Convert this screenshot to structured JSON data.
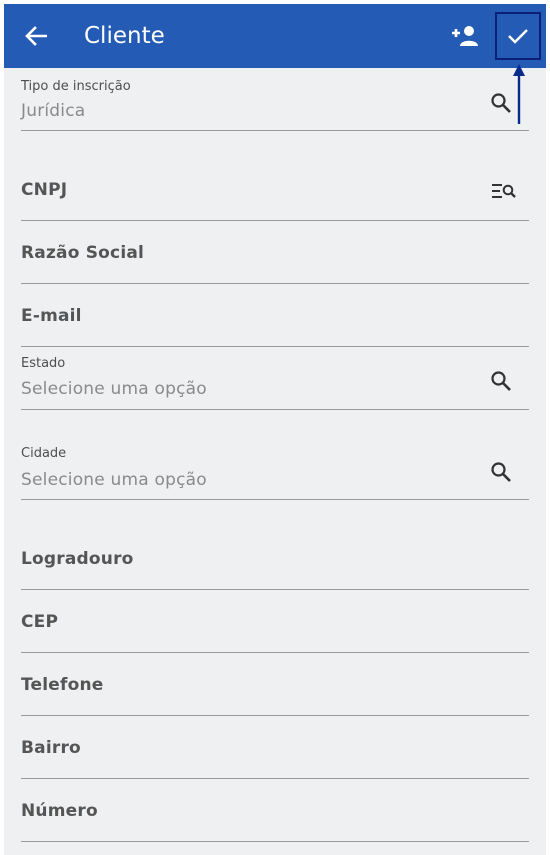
{
  "appbar": {
    "title": "Cliente",
    "color": "#235bb5"
  },
  "form": {
    "tipo_inscricao": {
      "label": "Tipo de inscrição",
      "value": "Jurídica"
    },
    "cnpj": {
      "label": "CNPJ"
    },
    "razao_social": {
      "label": "Razão Social"
    },
    "email": {
      "label": "E-mail"
    },
    "estado": {
      "label": "Estado",
      "placeholder": "Selecione uma opção"
    },
    "cidade": {
      "label": "Cidade",
      "placeholder": "Selecione uma opção"
    },
    "logradouro": {
      "label": "Logradouro"
    },
    "cep": {
      "label": "CEP"
    },
    "telefone": {
      "label": "Telefone"
    },
    "bairro": {
      "label": "Bairro"
    },
    "numero": {
      "label": "Número"
    }
  },
  "icons": {
    "back": "arrow-left-icon",
    "add_person": "person-add-icon",
    "confirm": "check-icon",
    "search": "search-icon",
    "list_search": "list-search-icon"
  }
}
